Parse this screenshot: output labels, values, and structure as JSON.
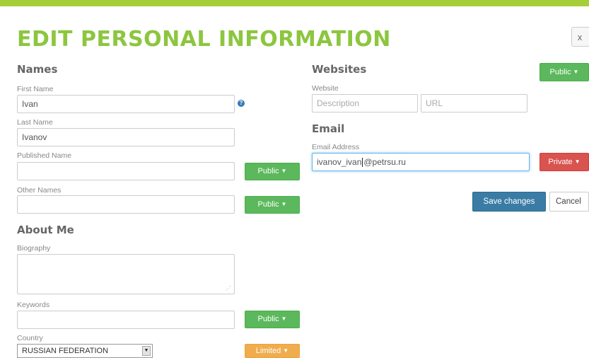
{
  "page": {
    "title": "EDIT PERSONAL INFORMATION",
    "close_label": "x"
  },
  "names": {
    "heading": "Names",
    "first_name": {
      "label": "First Name",
      "value": "Ivan",
      "help_icon": "question-circle-icon"
    },
    "last_name": {
      "label": "Last Name",
      "value": "Ivanov"
    },
    "published_name": {
      "label": "Published Name",
      "value": "",
      "visibility": "Public"
    },
    "other_names": {
      "label": "Other Names",
      "value": "",
      "visibility": "Public"
    }
  },
  "about": {
    "heading": "About Me",
    "biography": {
      "label": "Biography",
      "value": ""
    },
    "keywords": {
      "label": "Keywords",
      "value": "",
      "visibility": "Public"
    },
    "country": {
      "label": "Country",
      "value": "RUSSIAN FEDERATION",
      "visibility": "Limited"
    }
  },
  "websites": {
    "heading": "Websites",
    "visibility": "Public",
    "label": "Website",
    "description_placeholder": "Description",
    "url_placeholder": "URL"
  },
  "email": {
    "heading": "Email",
    "label": "Email Address",
    "value_before_cursor": "ivanov_ivan",
    "value_after_cursor": "@petrsu.ru",
    "visibility": "Private"
  },
  "actions": {
    "save_label": "Save changes",
    "cancel_label": "Cancel"
  },
  "colors": {
    "accent_green": "#8cc63f",
    "public_green": "#5cb85c",
    "private_red": "#d9534f",
    "limited_orange": "#f0ad4e",
    "save_blue": "#3a7ca5"
  }
}
